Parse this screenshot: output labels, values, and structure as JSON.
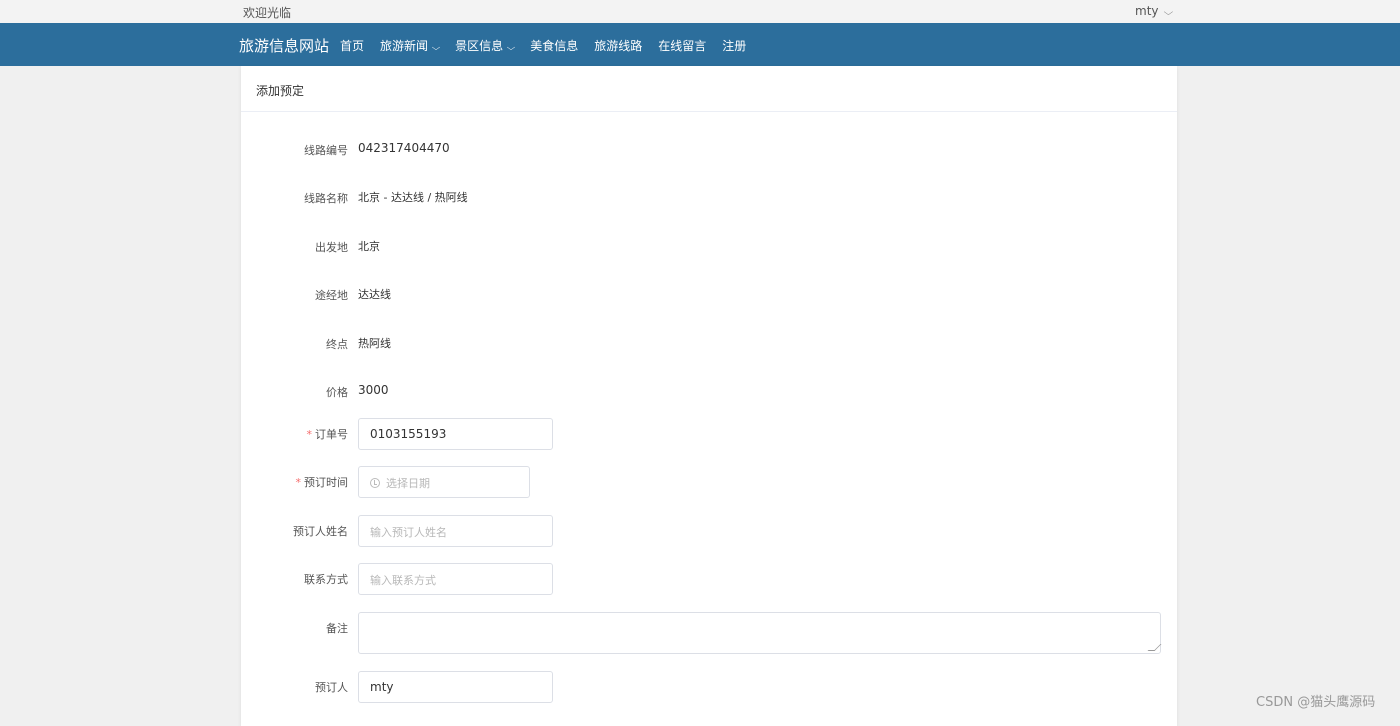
{
  "topbar": {
    "welcome": "欢迎光临",
    "user": "mty"
  },
  "navbar": {
    "brand": "旅游信息网站",
    "items": [
      {
        "label": "首页",
        "dropdown": false
      },
      {
        "label": "旅游新闻",
        "dropdown": true
      },
      {
        "label": "景区信息",
        "dropdown": true
      },
      {
        "label": "美食信息",
        "dropdown": false
      },
      {
        "label": "旅游线路",
        "dropdown": false
      },
      {
        "label": "在线留言",
        "dropdown": false
      },
      {
        "label": "注册",
        "dropdown": false
      }
    ],
    "chevron": "⌵"
  },
  "form": {
    "title": "添加预定",
    "route_no_label": "线路编号",
    "route_no": "042317404470",
    "route_name_label": "线路名称",
    "route_name": "北京 - 达达线 / 热阿线",
    "departure_label": "出发地",
    "departure": "北京",
    "via_label": "途经地",
    "via": "达达线",
    "destination_label": "终点",
    "destination": "热阿线",
    "price_label": "价格",
    "price": "3000",
    "required_mark": "*",
    "order_no_label": "订单号",
    "order_no": "0103155193",
    "book_time_label": "预订时间",
    "book_time_placeholder": "选择日期",
    "booker_name_label": "预订人姓名",
    "booker_name_placeholder": "输入预订人姓名",
    "contact_label": "联系方式",
    "contact_placeholder": "输入联系方式",
    "remark_label": "备注",
    "remark_value": "",
    "booker_label": "预订人",
    "booker": "mty"
  },
  "watermark": "CSDN @猫头鹰源码",
  "colors": {
    "navbar": "#2c6e9c",
    "required": "#f56c6c"
  }
}
